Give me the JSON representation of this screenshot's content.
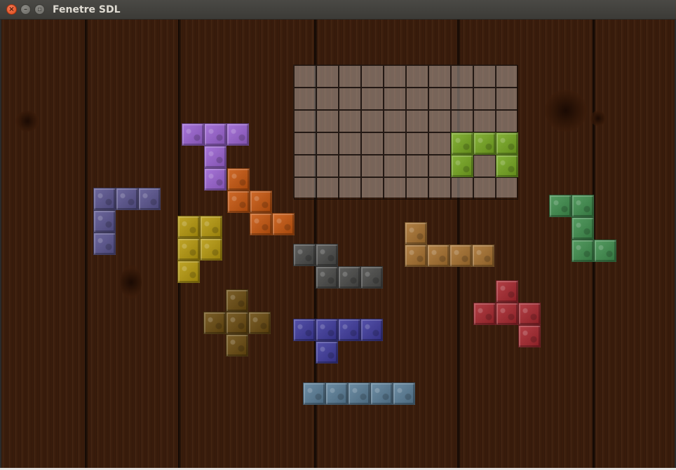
{
  "window": {
    "title": "Fenetre SDL",
    "controls": [
      {
        "name": "close-button",
        "glyph": "×",
        "icon": "close-icon"
      },
      {
        "name": "minimize-button",
        "glyph": "–",
        "icon": "minimize-icon"
      },
      {
        "name": "maximize-button",
        "glyph": "▫",
        "icon": "maximize-icon"
      }
    ]
  },
  "game": {
    "background": "wood-planks",
    "board": {
      "cols": 10,
      "rows": 6,
      "placed": [
        {
          "piece": "lime-u",
          "color": "#76a81f",
          "cells": [
            [
              7,
              3
            ],
            [
              8,
              3
            ],
            [
              9,
              3
            ],
            [
              7,
              4
            ],
            [
              9,
              4
            ]
          ]
        }
      ]
    },
    "pieces": [
      {
        "name": "purple-t-piece",
        "color": "#9c63d4",
        "cells": [
          [
            0,
            0
          ],
          [
            1,
            0
          ],
          [
            2,
            0
          ],
          [
            1,
            1
          ],
          [
            1,
            2
          ]
        ]
      },
      {
        "name": "orange-w-piece",
        "color": "#c9560d",
        "cells": [
          [
            0,
            0
          ],
          [
            0,
            1
          ],
          [
            1,
            1
          ],
          [
            1,
            2
          ],
          [
            2,
            2
          ]
        ]
      },
      {
        "name": "slate-l-piece",
        "color": "#5a5490",
        "cells": [
          [
            0,
            0
          ],
          [
            1,
            0
          ],
          [
            2,
            0
          ],
          [
            0,
            1
          ],
          [
            0,
            2
          ]
        ]
      },
      {
        "name": "yellow-p-piece",
        "color": "#b89a0c",
        "cells": [
          [
            0,
            0
          ],
          [
            1,
            0
          ],
          [
            0,
            1
          ],
          [
            1,
            1
          ],
          [
            0,
            2
          ]
        ]
      },
      {
        "name": "gray-n-piece",
        "color": "#4a4a48",
        "cells": [
          [
            0,
            0
          ],
          [
            1,
            0
          ],
          [
            1,
            1
          ],
          [
            2,
            1
          ],
          [
            3,
            1
          ]
        ]
      },
      {
        "name": "tan-l-piece",
        "color": "#a8712e",
        "cells": [
          [
            0,
            0
          ],
          [
            0,
            1
          ],
          [
            1,
            1
          ],
          [
            2,
            1
          ],
          [
            3,
            1
          ]
        ]
      },
      {
        "name": "green-s-piece",
        "color": "#3f8f4d",
        "cells": [
          [
            0,
            0
          ],
          [
            1,
            0
          ],
          [
            1,
            1
          ],
          [
            1,
            2
          ],
          [
            2,
            2
          ]
        ]
      },
      {
        "name": "brown-x-piece",
        "color": "#6a4a0e",
        "cells": [
          [
            1,
            0
          ],
          [
            0,
            1
          ],
          [
            1,
            1
          ],
          [
            2,
            1
          ],
          [
            1,
            2
          ]
        ]
      },
      {
        "name": "red-f-piece",
        "color": "#a8262d",
        "cells": [
          [
            1,
            0
          ],
          [
            0,
            1
          ],
          [
            1,
            1
          ],
          [
            2,
            1
          ],
          [
            2,
            2
          ]
        ]
      },
      {
        "name": "blue-y-piece",
        "color": "#3e3a9e",
        "cells": [
          [
            0,
            0
          ],
          [
            1,
            0
          ],
          [
            2,
            0
          ],
          [
            3,
            0
          ],
          [
            1,
            1
          ]
        ]
      },
      {
        "name": "steel-i-piece",
        "color": "#5a7e98",
        "cells": [
          [
            0,
            0
          ],
          [
            1,
            0
          ],
          [
            2,
            0
          ],
          [
            3,
            0
          ],
          [
            4,
            0
          ]
        ]
      }
    ]
  }
}
